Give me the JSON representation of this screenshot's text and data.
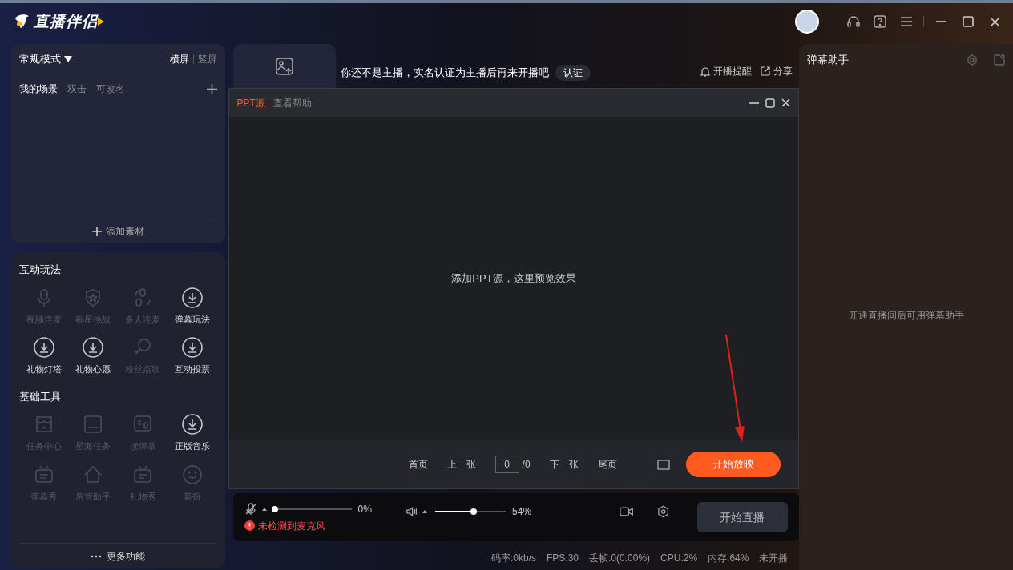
{
  "app": {
    "logo_text": "直播伴侣"
  },
  "scene_panel": {
    "mode": "常规模式",
    "orientations": [
      {
        "label": "横屏",
        "selected": true
      },
      {
        "label": "竖屏",
        "selected": false
      }
    ],
    "scene_title": "我的场景",
    "hints": [
      "双击",
      "可改名"
    ],
    "add_material": "添加素材"
  },
  "tool_sections": [
    {
      "title": "互动玩法",
      "items": [
        {
          "label": "视频连麦",
          "kind": "mic",
          "disabled": true
        },
        {
          "label": "福星挑战",
          "kind": "shield",
          "disabled": true
        },
        {
          "label": "多人连麦",
          "kind": "multimic",
          "disabled": true
        },
        {
          "label": "弹幕玩法",
          "kind": "download",
          "disabled": false
        },
        {
          "label": "礼物灯塔",
          "kind": "download",
          "disabled": false
        },
        {
          "label": "礼物心愿",
          "kind": "download",
          "disabled": false
        },
        {
          "label": "粉丝点歌",
          "kind": "note",
          "disabled": true
        },
        {
          "label": "互动投票",
          "kind": "download",
          "disabled": false
        }
      ]
    },
    {
      "title": "基础工具",
      "items": [
        {
          "label": "任务中心",
          "kind": "store",
          "disabled": true
        },
        {
          "label": "星海任务",
          "kind": "ad",
          "disabled": true
        },
        {
          "label": "读弹幕",
          "kind": "reader",
          "disabled": true
        },
        {
          "label": "正版音乐",
          "kind": "download",
          "disabled": false
        },
        {
          "label": "弹幕秀",
          "kind": "tv",
          "disabled": true
        },
        {
          "label": "房管助手",
          "kind": "house",
          "disabled": true
        },
        {
          "label": "礼物秀",
          "kind": "tv",
          "disabled": true
        },
        {
          "label": "装扮",
          "kind": "smile",
          "disabled": true
        }
      ]
    }
  ],
  "more_features": "更多功能",
  "notice": {
    "text": "你还不是主播，实名认证为主播后再来开播吧",
    "button": "认证",
    "actions": [
      "开播提醒",
      "分享"
    ]
  },
  "ppt_dialog": {
    "tabs": [
      {
        "label": "PPT源",
        "selected": true
      },
      {
        "label": "查看帮助",
        "selected": false
      }
    ],
    "empty_text": "添加PPT源，这里预览效果",
    "nav": {
      "first": "首页",
      "prev": "上一张",
      "page": "0",
      "total": "/0",
      "next": "下一张",
      "last": "尾页"
    },
    "start_button": "开始放映"
  },
  "audio": {
    "mic": {
      "level": 0,
      "reading": "0%",
      "warning": "未检测到麦克风"
    },
    "speaker": {
      "level": 0.54,
      "reading": "54%"
    },
    "go_live": "开始直播"
  },
  "status_bar": [
    "码率:0kb/s",
    "FPS:30",
    "丢帧:0(0.00%)",
    "CPU:2%",
    "内存:64%",
    "未开播"
  ],
  "danmu_panel": {
    "title": "弹幕助手",
    "empty_text": "开通直播间后可用弹幕助手"
  }
}
